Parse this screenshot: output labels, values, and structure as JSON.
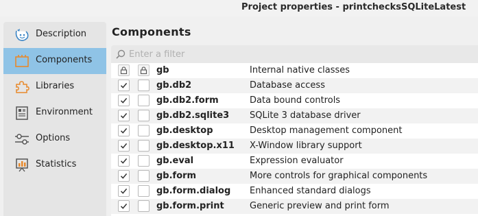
{
  "window": {
    "title": "Project properties - printchecksSQLiteLatest"
  },
  "sidebar": {
    "items": [
      {
        "label": "Description",
        "icon": "description-icon",
        "active": false
      },
      {
        "label": "Components",
        "icon": "components-icon",
        "active": true
      },
      {
        "label": "Libraries",
        "icon": "puzzle-icon",
        "active": false
      },
      {
        "label": "Environment",
        "icon": "environment-icon",
        "active": false
      },
      {
        "label": "Options",
        "icon": "options-icon",
        "active": false
      },
      {
        "label": "Statistics",
        "icon": "statistics-icon",
        "active": false
      }
    ]
  },
  "main": {
    "heading": "Components",
    "filter": {
      "placeholder": "Enter a filter",
      "value": ""
    },
    "components": [
      {
        "name": "gb",
        "description": "Internal native classes",
        "locked": true,
        "checked": true
      },
      {
        "name": "gb.db2",
        "description": "Database access",
        "locked": false,
        "checked": true
      },
      {
        "name": "gb.db2.form",
        "description": "Data bound controls",
        "locked": false,
        "checked": true
      },
      {
        "name": "gb.db2.sqlite3",
        "description": "SQLite 3 database driver",
        "locked": false,
        "checked": true
      },
      {
        "name": "gb.desktop",
        "description": "Desktop management component",
        "locked": false,
        "checked": true
      },
      {
        "name": "gb.desktop.x11",
        "description": "X-Window library support",
        "locked": false,
        "checked": true
      },
      {
        "name": "gb.eval",
        "description": "Expression evaluator",
        "locked": false,
        "checked": true
      },
      {
        "name": "gb.form",
        "description": "More controls for graphical components",
        "locked": false,
        "checked": true
      },
      {
        "name": "gb.form.dialog",
        "description": "Enhanced standard dialogs",
        "locked": false,
        "checked": true
      },
      {
        "name": "gb.form.print",
        "description": "Generic preview and print form",
        "locked": false,
        "checked": true
      }
    ]
  },
  "colors": {
    "active_item": "#8fc3e6",
    "sidebar_bg": "#e5e5e5",
    "icon_blue": "#3d86c6",
    "icon_orange": "#e8892b"
  }
}
